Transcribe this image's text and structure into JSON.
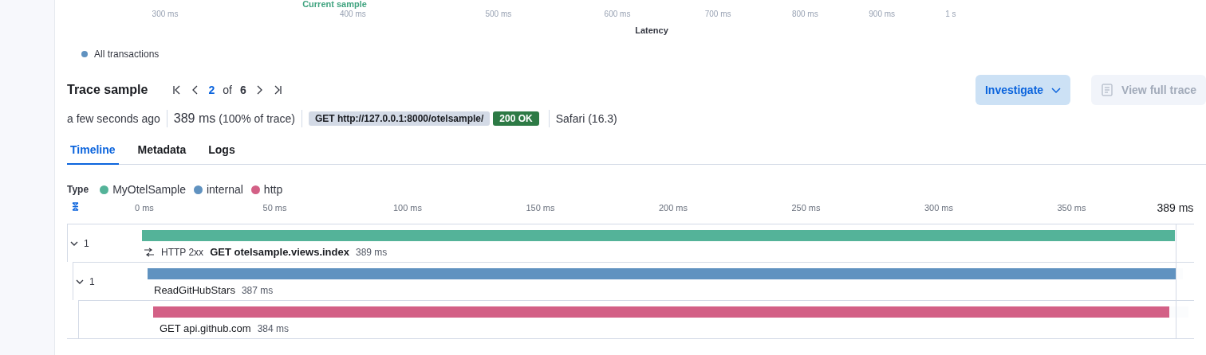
{
  "latency_axis": {
    "marker": {
      "label": "Current sample"
    },
    "xlabel": "Latency",
    "xticks": [
      "300 ms",
      "400 ms",
      "500 ms",
      "600 ms",
      "700 ms",
      "800 ms",
      "900 ms",
      "1 s"
    ]
  },
  "legend": [
    {
      "label": "All transactions",
      "color": "#6092c0"
    }
  ],
  "trace_sample": {
    "title": "Trace sample",
    "pager": {
      "current": "2",
      "of": "of",
      "total": "6"
    },
    "buttons": [
      {
        "kind": "dropdown",
        "label": "Investigate",
        "disabled": false
      },
      {
        "kind": "document",
        "label": "View full trace",
        "disabled": true
      }
    ]
  },
  "summary": {
    "time": "a few seconds ago",
    "duration": "389 ms",
    "share": "(100% of trace)",
    "request": "GET http://127.0.0.1:8000/otelsample/",
    "status": "200 OK",
    "user_agent": "Safari (16.3)"
  },
  "tabs": [
    {
      "label": "Timeline",
      "selected": true
    },
    {
      "label": "Metadata",
      "selected": false
    },
    {
      "label": "Logs",
      "selected": false
    }
  ],
  "type_legend": {
    "title": "Type",
    "items": [
      {
        "label": "MyOtelSample",
        "color": "#54b399"
      },
      {
        "label": "internal",
        "color": "#6092c0"
      },
      {
        "label": "http",
        "color": "#d36086"
      }
    ]
  },
  "timeline": {
    "ticks": [
      "0 ms",
      "50 ms",
      "100 ms",
      "150 ms",
      "200 ms",
      "250 ms",
      "300 ms",
      "350 ms"
    ],
    "end_label": "389 ms"
  },
  "spans": [
    {
      "count": "1",
      "expanded": true,
      "status": "HTTP 2xx",
      "name": "GET otelsample.views.index",
      "duration": "389 ms",
      "color": "#54b399",
      "level": 1,
      "children": [
        {
          "count": "1",
          "expanded": true,
          "name": "ReadGitHubStars",
          "duration": "387 ms",
          "color": "#6092c0",
          "level": 0.995,
          "children": [
            {
              "name": "GET api.github.com",
              "duration": "384 ms",
              "color": "#d36086",
              "level": 0.984
            }
          ]
        }
      ]
    }
  ]
}
